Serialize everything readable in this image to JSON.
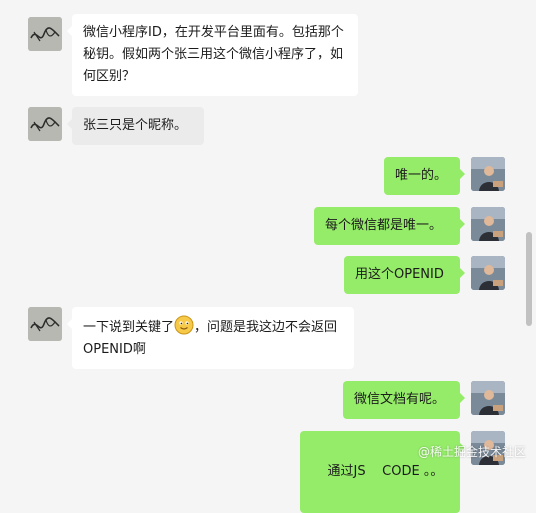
{
  "messages": [
    {
      "side": "left",
      "text": "微信小程序ID，在开发平台里面有。包括那个秘钥。假如两个张三用这个微信小程序了，如何区别？"
    },
    {
      "side": "left",
      "text": "张三只是个昵称。"
    },
    {
      "side": "right",
      "text": "唯一的。"
    },
    {
      "side": "right",
      "text": "每个微信都是唯一。"
    },
    {
      "side": "right",
      "text": "用这个OPENID"
    },
    {
      "side": "left",
      "text_before": "一下说到关键了",
      "emoji": "smile-emoji",
      "text_after": "，问题是我这边不会返回OPENID啊"
    },
    {
      "side": "right",
      "text": "微信文档有呢。"
    },
    {
      "side": "right",
      "text": "通过JS    CODE 。。"
    }
  ],
  "watermark": "@稀土掘金技术社区",
  "colors": {
    "background": "#f5f5f5",
    "incoming_bubble": "#ffffff",
    "outgoing_bubble": "#95ec69",
    "scrollbar_thumb": "#c1c1c1"
  }
}
